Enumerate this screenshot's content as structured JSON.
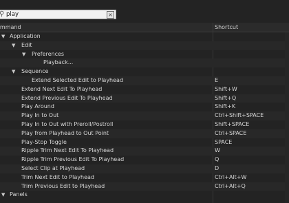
{
  "search": {
    "value": "play",
    "icon": "search-icon",
    "clear_icon": "close-icon"
  },
  "columns": {
    "command": "ommand",
    "shortcut": "Shortcut"
  },
  "rows": [
    {
      "label": "Application",
      "shortcut": "",
      "level": 0,
      "expander": "▼"
    },
    {
      "label": "Edit",
      "shortcut": "",
      "level": 1,
      "expander": "▼"
    },
    {
      "label": "Preferences",
      "shortcut": "",
      "level": 2,
      "expander": "▼"
    },
    {
      "label": "Playback...",
      "shortcut": "",
      "level": 3,
      "expander": ""
    },
    {
      "label": "Sequence",
      "shortcut": "",
      "level": 1,
      "expander": "▼"
    },
    {
      "label": "Extend Selected Edit to Playhead",
      "shortcut": "E",
      "level": 3,
      "expander": ""
    },
    {
      "label": "Extend Next Edit To Playhead",
      "shortcut": "Shift+W",
      "level": 2,
      "expander": ""
    },
    {
      "label": "Extend Previous Edit To Playhead",
      "shortcut": "Shift+Q",
      "level": 2,
      "expander": ""
    },
    {
      "label": "Play Around",
      "shortcut": "Shift+K",
      "level": 2,
      "expander": ""
    },
    {
      "label": "Play In to Out",
      "shortcut": "Ctrl+Shift+SPACE",
      "level": 2,
      "expander": ""
    },
    {
      "label": "Play In to Out with Preroll/Postroll",
      "shortcut": "Shift+SPACE",
      "level": 2,
      "expander": ""
    },
    {
      "label": "Play from Playhead to Out Point",
      "shortcut": "Ctrl+SPACE",
      "level": 2,
      "expander": ""
    },
    {
      "label": "Play-Stop Toggle",
      "shortcut": "SPACE",
      "level": 2,
      "expander": ""
    },
    {
      "label": "Ripple Trim Next Edit To Playhead",
      "shortcut": "W",
      "level": 2,
      "expander": ""
    },
    {
      "label": "Ripple Trim Previous Edit To Playhead",
      "shortcut": "Q",
      "level": 2,
      "expander": ""
    },
    {
      "label": "Select Clip at Playhead",
      "shortcut": "D",
      "level": 2,
      "expander": ""
    },
    {
      "label": "Trim Next Edit to Playhead",
      "shortcut": "Ctrl+Alt+W",
      "level": 2,
      "expander": ""
    },
    {
      "label": "Trim Previous Edit to Playhead",
      "shortcut": "Ctrl+Alt+Q",
      "level": 2,
      "expander": ""
    },
    {
      "label": "Panels",
      "shortcut": "",
      "level": 0,
      "expander": "▼"
    }
  ]
}
